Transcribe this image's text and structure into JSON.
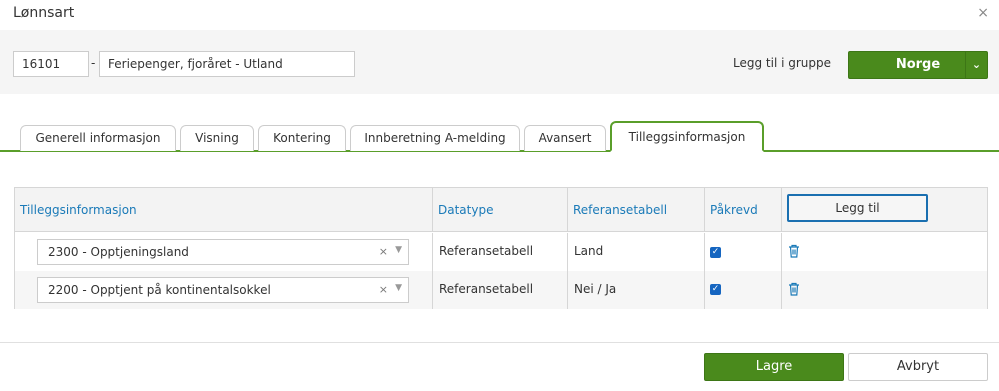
{
  "dialog": {
    "title": "Lønnsart",
    "close_icon": "×"
  },
  "header": {
    "code_value": "16101",
    "separator": "-",
    "name_value": "Feriepenger, fjoråret - Utland",
    "group_label": "Legg til i gruppe",
    "group_button_label": "Norge",
    "group_button_caret": "⌄"
  },
  "tabs": [
    {
      "label": "Generell informasjon"
    },
    {
      "label": "Visning"
    },
    {
      "label": "Kontering"
    },
    {
      "label": "Innberetning A-melding"
    },
    {
      "label": "Avansert"
    },
    {
      "label": "Tilleggsinformasjon"
    }
  ],
  "grid": {
    "headers": [
      "Tilleggsinformasjon",
      "Datatype",
      "Referansetabell",
      "Påkrevd"
    ],
    "add_button_label": "Legg til",
    "rows": [
      {
        "info": "2300 - Opptjeningsland",
        "datatype": "Referansetabell",
        "reference": "Land",
        "required": true
      },
      {
        "info": "2200 - Opptjent på kontinentalsokkel",
        "datatype": "Referansetabell",
        "reference": "Nei / Ja",
        "required": true
      }
    ],
    "clear_glyph": "×",
    "dropdown_glyph": "▼",
    "check_glyph": "✓"
  },
  "footer": {
    "save_label": "Lagre",
    "cancel_label": "Avbryt"
  },
  "colors": {
    "accent_green": "#4a8a1c",
    "tab_green": "#5a9e2a",
    "link_blue": "#1a7ab8",
    "checkbox_blue": "#1565c0"
  }
}
